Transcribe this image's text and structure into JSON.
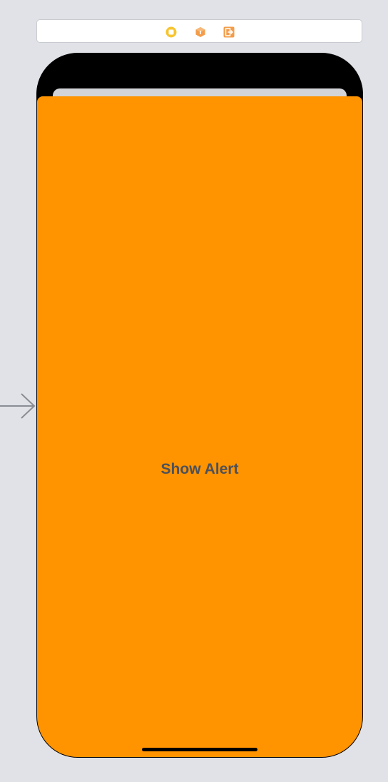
{
  "scene_dock": {
    "icons": [
      "view-controller-icon",
      "first-responder-icon",
      "exit-icon"
    ]
  },
  "colors": {
    "canvas_background": "#e0e2e7",
    "screen_background": "#ff9300",
    "button_text": "#4d5159",
    "device_frame": "#000000"
  },
  "main_view": {
    "button_label": "Show Alert"
  }
}
